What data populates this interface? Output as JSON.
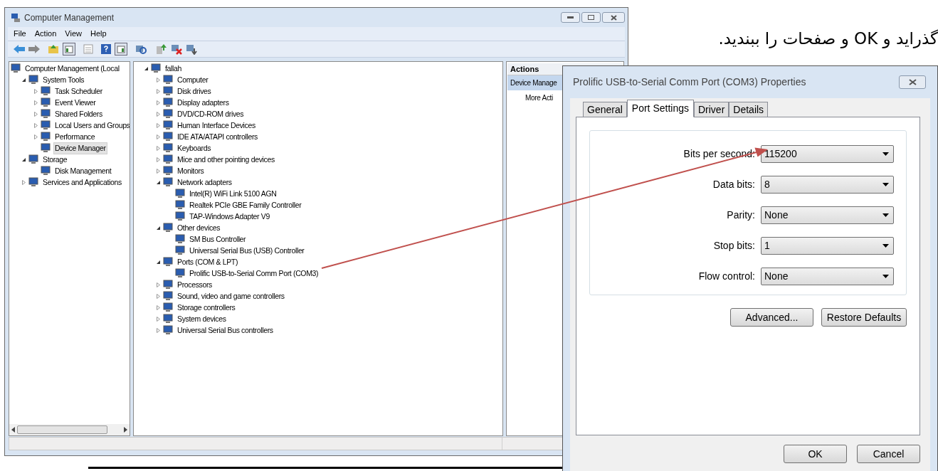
{
  "caption": "گذرايد و OK و صفحات را ببنديد.",
  "main_window": {
    "title": "Computer Management",
    "menu": [
      "File",
      "Action",
      "View",
      "Help"
    ],
    "nav_tree": [
      {
        "label": "Computer Management (Local",
        "children": [
          {
            "label": "System Tools",
            "expanded": true,
            "children": [
              {
                "label": "Task Scheduler",
                "expanded": false,
                "selected": false
              },
              {
                "label": "Event Viewer",
                "expanded": false,
                "selected": false
              },
              {
                "label": "Shared Folders",
                "expanded": false,
                "selected": false
              },
              {
                "label": "Local Users and Groups",
                "expanded": false,
                "selected": false
              },
              {
                "label": "Performance",
                "expanded": false,
                "selected": false
              },
              {
                "label": "Device Manager",
                "selected": true
              }
            ],
            "selected": false
          },
          {
            "label": "Storage",
            "expanded": true,
            "selected": false,
            "children": [
              {
                "label": "Disk Management",
                "selected": false
              }
            ]
          },
          {
            "label": "Services and Applications",
            "expanded": false,
            "selected": false
          }
        ],
        "selected": false
      }
    ],
    "device_tree": [
      {
        "label": "fallah",
        "expanded": true,
        "children": [
          {
            "label": "Computer",
            "expanded": false
          },
          {
            "label": "Disk drives",
            "expanded": false
          },
          {
            "label": "Display adapters",
            "expanded": false
          },
          {
            "label": "DVD/CD-ROM drives",
            "expanded": false
          },
          {
            "label": "Human Interface Devices",
            "expanded": false
          },
          {
            "label": "IDE ATA/ATAPI controllers",
            "expanded": false
          },
          {
            "label": "Keyboards",
            "expanded": false
          },
          {
            "label": "Mice and other pointing devices",
            "expanded": false
          },
          {
            "label": "Monitors",
            "expanded": false
          },
          {
            "label": "Network adapters",
            "expanded": true,
            "children": [
              {
                "label": "Intel(R) WiFi Link 5100 AGN"
              },
              {
                "label": "Realtek PCIe GBE Family Controller"
              },
              {
                "label": "TAP-Windows Adapter V9"
              }
            ]
          },
          {
            "label": "Other devices",
            "expanded": true,
            "children": [
              {
                "label": "SM Bus Controller"
              },
              {
                "label": "Universal Serial Bus (USB) Controller"
              }
            ]
          },
          {
            "label": "Ports (COM & LPT)",
            "expanded": true,
            "children": [
              {
                "label": "Prolific USB-to-Serial Comm Port (COM3)"
              }
            ]
          },
          {
            "label": "Processors",
            "expanded": false
          },
          {
            "label": "Sound, video and game controllers",
            "expanded": false
          },
          {
            "label": "Storage controllers",
            "expanded": false
          },
          {
            "label": "System devices",
            "expanded": false
          },
          {
            "label": "Universal Serial Bus controllers",
            "expanded": false
          }
        ]
      }
    ],
    "actions": {
      "header": "Actions",
      "items": [
        {
          "label": "Device Manage",
          "selected": true
        },
        {
          "label": "More Acti",
          "selected": false
        }
      ]
    }
  },
  "dialog": {
    "title": "Prolific USB-to-Serial Comm Port (COM3) Properties",
    "tabs": [
      {
        "label": "General",
        "selected": false
      },
      {
        "label": "Port Settings",
        "selected": true
      },
      {
        "label": "Driver",
        "selected": false
      },
      {
        "label": "Details",
        "selected": false
      }
    ],
    "fields": [
      {
        "label": "Bits per second:",
        "value": "115200"
      },
      {
        "label": "Data bits:",
        "value": "8"
      },
      {
        "label": "Parity:",
        "value": "None"
      },
      {
        "label": "Stop bits:",
        "value": "1"
      },
      {
        "label": "Flow control:",
        "value": "None"
      }
    ],
    "panel_buttons": [
      "Advanced...",
      "Restore Defaults"
    ],
    "buttons": [
      "OK",
      "Cancel"
    ]
  }
}
